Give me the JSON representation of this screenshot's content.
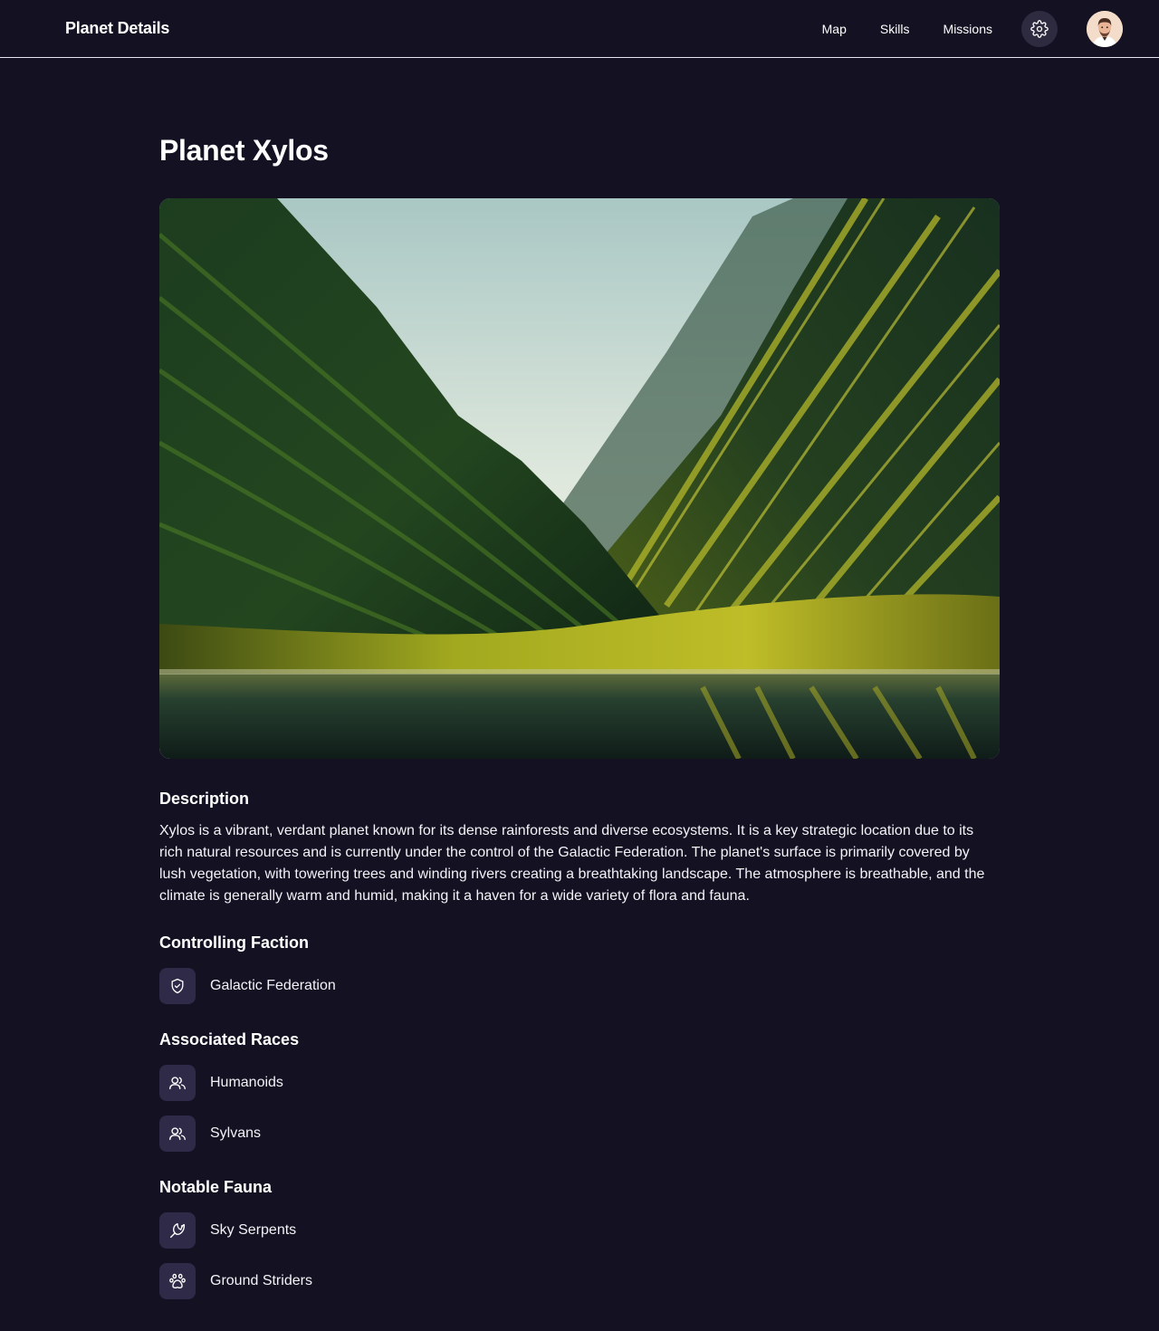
{
  "header": {
    "brand": "Planet Details",
    "nav": [
      "Map",
      "Skills",
      "Missions"
    ],
    "settings_icon": "gear-icon",
    "avatar_icon": "user-avatar"
  },
  "planet": {
    "title": "Planet Xylos",
    "hero_image": "green mountain valley with river landscape",
    "description_heading": "Description",
    "description": "Xylos is a vibrant, verdant planet known for its dense rainforests and diverse ecosystems. It is a key strategic location due to its rich natural resources and is currently under the control of the Galactic Federation. The planet's surface is primarily covered by lush vegetation, with towering trees and winding rivers creating a breathtaking landscape. The atmosphere is breathable, and the climate is generally warm and humid, making it a haven for a wide variety of flora and fauna."
  },
  "faction": {
    "heading": "Controlling Faction",
    "items": [
      {
        "label": "Galactic Federation",
        "icon": "shield-check-icon"
      }
    ]
  },
  "races": {
    "heading": "Associated Races",
    "items": [
      {
        "label": "Humanoids",
        "icon": "users-icon"
      },
      {
        "label": "Sylvans",
        "icon": "users-icon"
      }
    ]
  },
  "fauna": {
    "heading": "Notable Fauna",
    "items": [
      {
        "label": "Sky Serpents",
        "icon": "bird-icon"
      },
      {
        "label": "Ground Striders",
        "icon": "paw-icon"
      }
    ]
  },
  "colors": {
    "background": "#141122",
    "icon_tile": "#2e2a48",
    "settings_button": "#2e2a40",
    "divider": "#e8e6ee"
  }
}
